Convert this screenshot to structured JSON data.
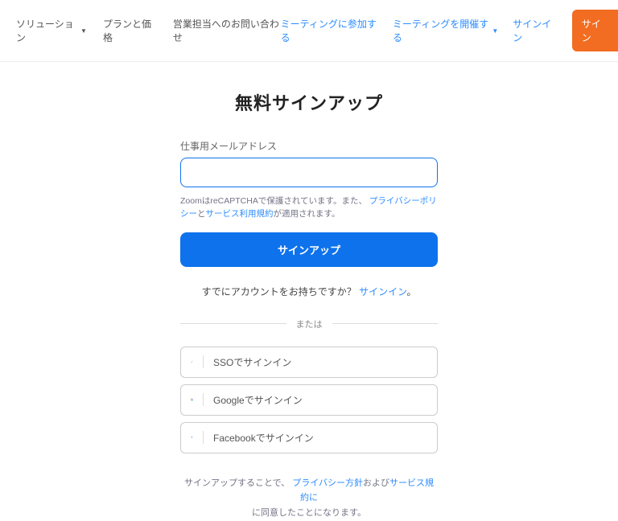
{
  "nav": {
    "left": {
      "solutions": "ソリューション",
      "plans": "プランと価格",
      "contact": "営業担当へのお問い合わせ"
    },
    "right": {
      "join": "ミーティングに参加する",
      "host": "ミーティングを開催する",
      "signin": "サインイン",
      "signup_btn": "サイン"
    }
  },
  "main": {
    "title": "無料サインアップ",
    "email_label": "仕事用メールアドレス",
    "email_value": "",
    "recaptcha_pre": "ZoomはreCAPTCHAで保護されています。また、",
    "privacy_policy": "プライバシーポリシー",
    "and": "と",
    "tos": "サービス利用規約",
    "recaptcha_post": "が適用されます。",
    "signup_btn": "サインアップ",
    "already_q": "すでにアカウントをお持ちですか？",
    "already_link": "サインイン",
    "already_period": "。",
    "or": "または",
    "sso": "SSOでサインイン",
    "google": "Googleでサインイン",
    "facebook": "Facebookでサインイン",
    "agree_pre": "サインアップすることで、",
    "agree_privacy": "プライバシー方針",
    "agree_and": "および",
    "agree_tos": "サービス規約に",
    "agree_post": "に同意したことになります。"
  }
}
